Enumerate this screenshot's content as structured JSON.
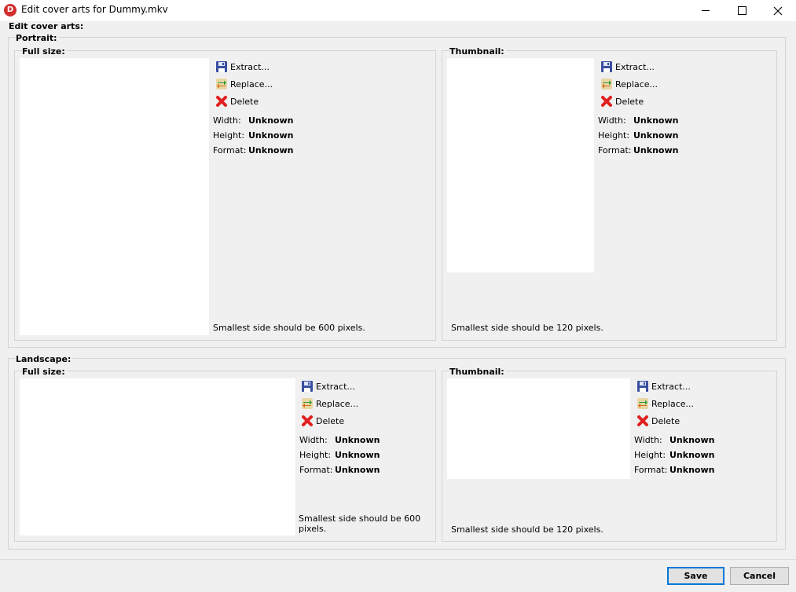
{
  "window": {
    "title": "Edit cover arts for Dummy.mkv",
    "icon_letter": "D"
  },
  "heading": "Edit cover arts:",
  "portrait": {
    "label": "Portrait:",
    "full": {
      "label": "Full size:",
      "extract": "Extract...",
      "replace": "Replace...",
      "delete": "Delete",
      "width_label": "Width:",
      "width": "Unknown",
      "height_label": "Height:",
      "height": "Unknown",
      "format_label": "Format:",
      "format": "Unknown",
      "hint": "Smallest side should be 600 pixels."
    },
    "thumb": {
      "label": "Thumbnail:",
      "extract": "Extract...",
      "replace": "Replace...",
      "delete": "Delete",
      "width_label": "Width:",
      "width": "Unknown",
      "height_label": "Height:",
      "height": "Unknown",
      "format_label": "Format:",
      "format": "Unknown",
      "hint": "Smallest side should be 120 pixels."
    }
  },
  "landscape": {
    "label": "Landscape:",
    "full": {
      "label": "Full size:",
      "extract": "Extract...",
      "replace": "Replace...",
      "delete": "Delete",
      "width_label": "Width:",
      "width": "Unknown",
      "height_label": "Height:",
      "height": "Unknown",
      "format_label": "Format:",
      "format": "Unknown",
      "hint": "Smallest side should be 600 pixels."
    },
    "thumb": {
      "label": "Thumbnail:",
      "extract": "Extract...",
      "replace": "Replace...",
      "delete": "Delete",
      "width_label": "Width:",
      "width": "Unknown",
      "height_label": "Height:",
      "height": "Unknown",
      "format_label": "Format:",
      "format": "Unknown",
      "hint": "Smallest side should be 120 pixels."
    }
  },
  "footer": {
    "save": "Save",
    "cancel": "Cancel"
  },
  "icons": {
    "extract": "floppy-disk-icon",
    "replace": "swap-arrows-icon",
    "delete": "red-x-icon"
  },
  "colors": {
    "delete_red": "#e02020",
    "accent_border": "#0078d7"
  }
}
